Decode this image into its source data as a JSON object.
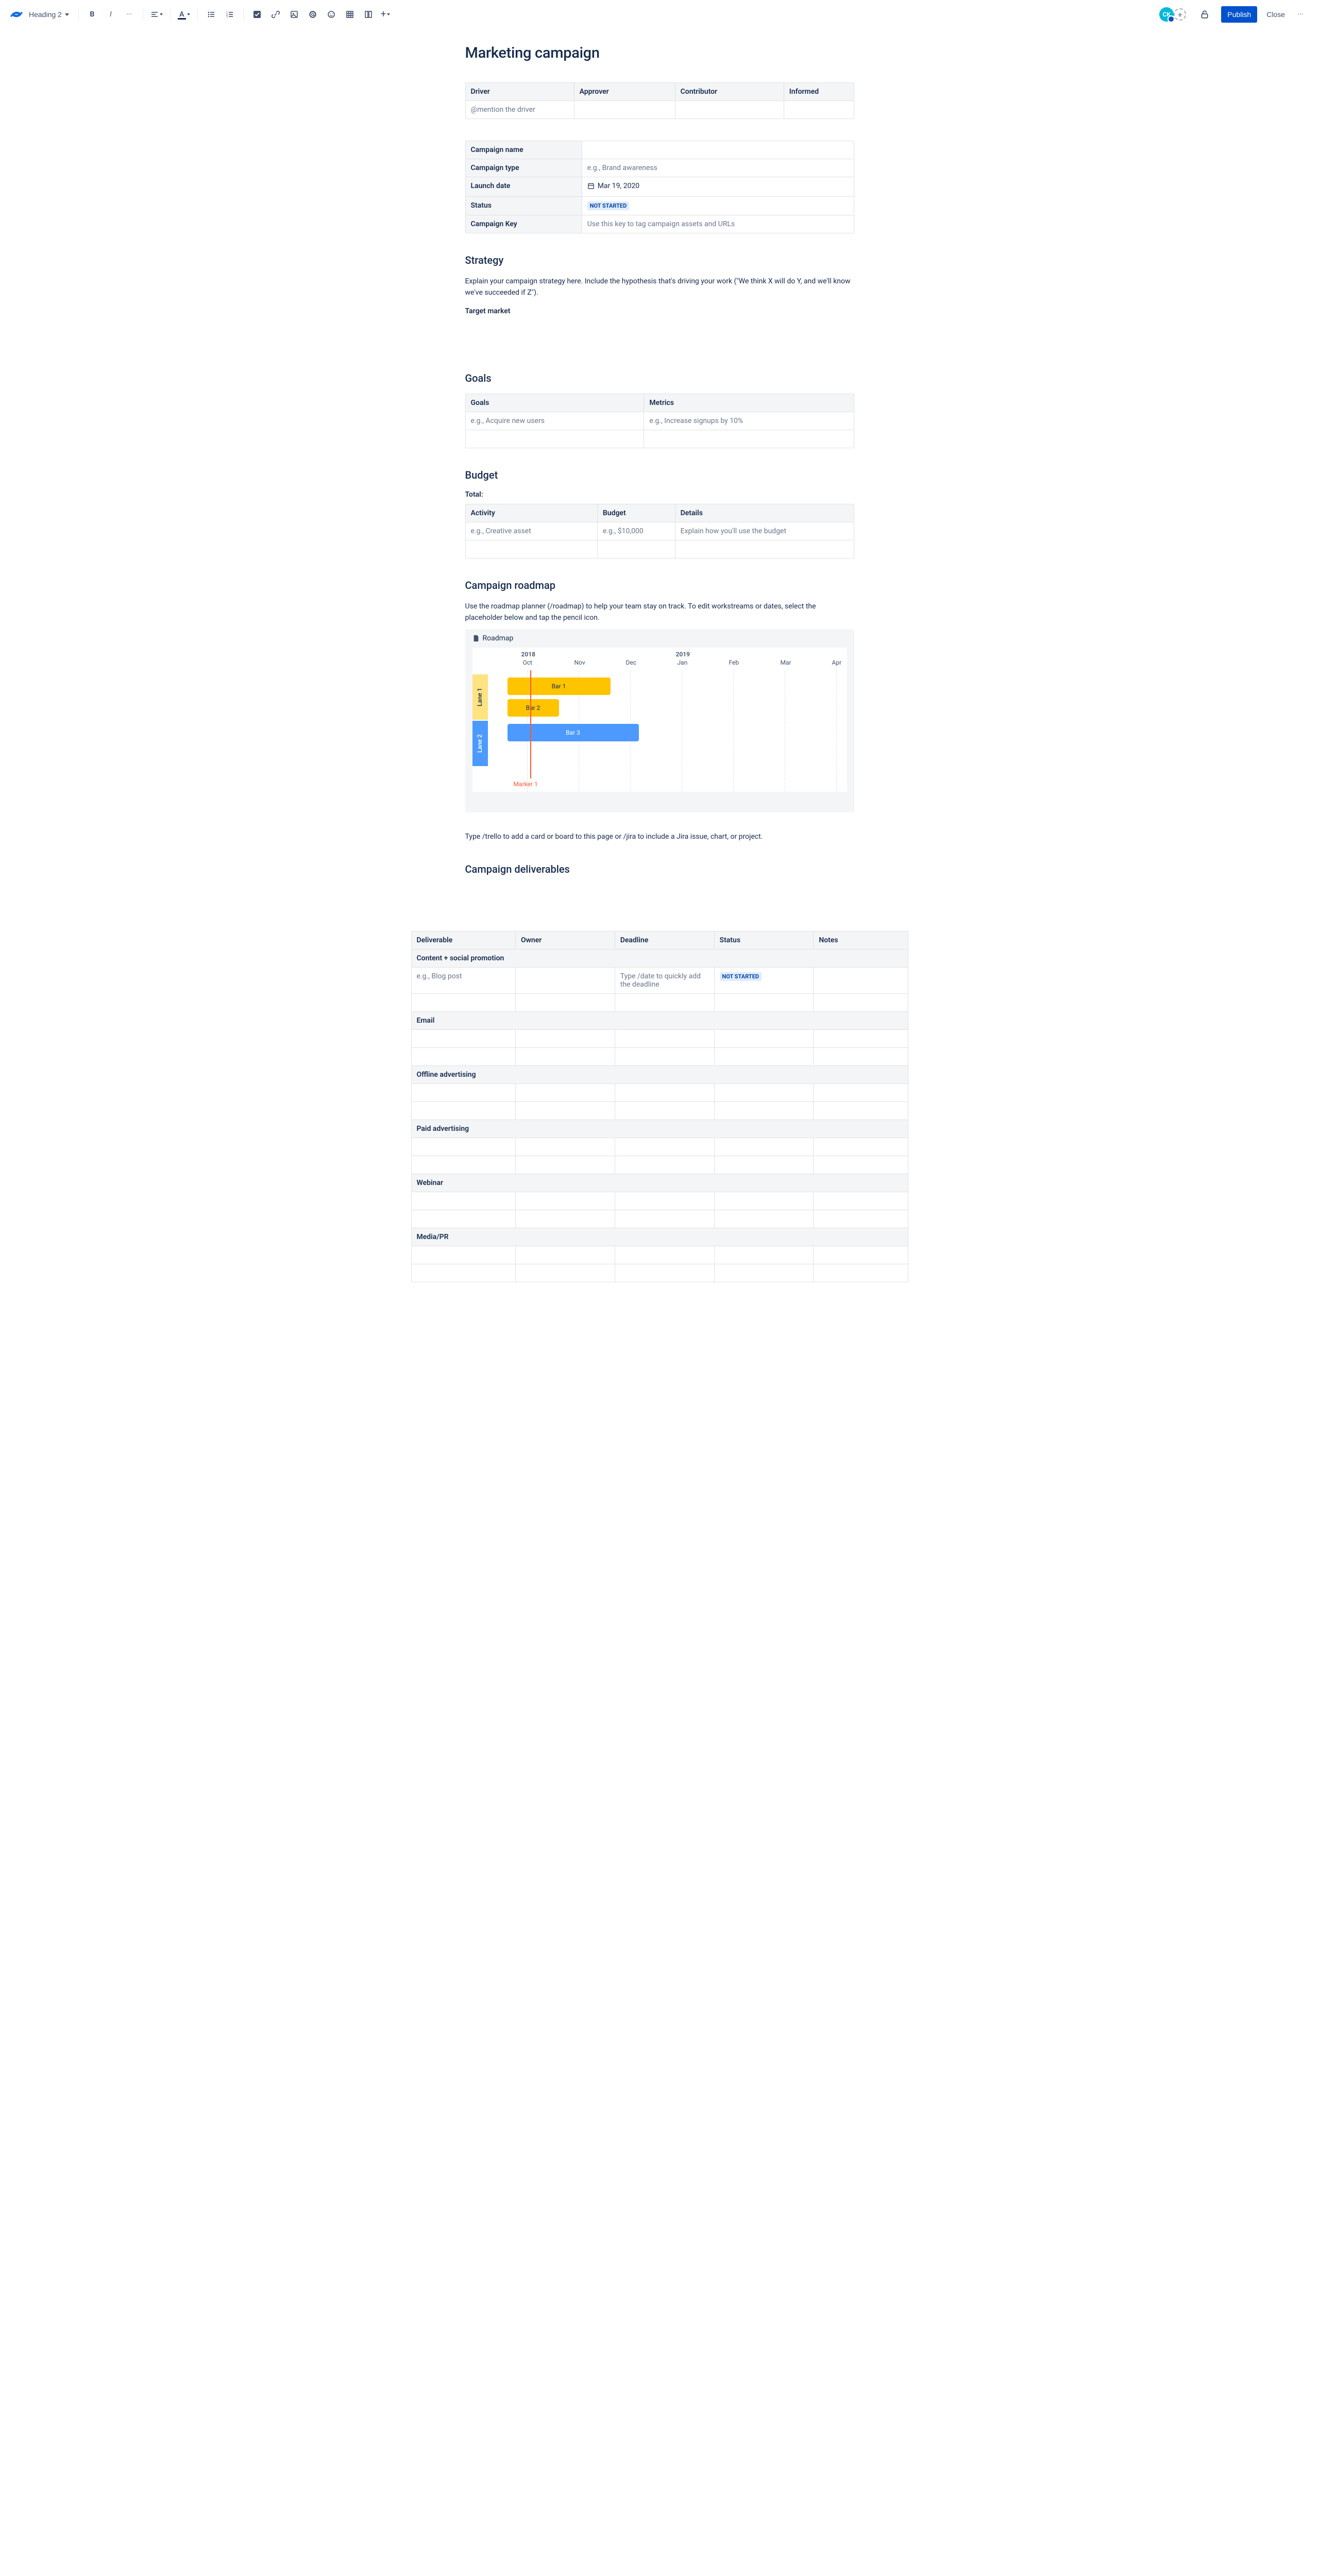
{
  "toolbar": {
    "heading_selector": "Heading 2",
    "publish": "Publish",
    "close": "Close",
    "avatar_initials": "CK"
  },
  "page": {
    "title": "Marketing campaign"
  },
  "raci": {
    "headers": {
      "driver": "Driver",
      "approver": "Approver",
      "contributor": "Contributor",
      "informed": "Informed"
    },
    "row": {
      "driver": "@mention the driver",
      "approver": "",
      "contributor": "",
      "informed": ""
    }
  },
  "details": {
    "campaign_name": {
      "label": "Campaign name",
      "value": ""
    },
    "campaign_type": {
      "label": "Campaign type",
      "value": "e.g., Brand awareness"
    },
    "launch_date": {
      "label": "Launch date",
      "value": "Mar 19, 2020"
    },
    "status": {
      "label": "Status",
      "value": "NOT STARTED"
    },
    "campaign_key": {
      "label": "Campaign Key",
      "value": "Use this key to tag campaign assets and URLs"
    }
  },
  "strategy": {
    "heading": "Strategy",
    "body": "Explain your campaign strategy here. Include the hypothesis that's driving your work (\"We think X will do Y, and we'll know we've succeeded if Z\").",
    "target_market_label": "Target market"
  },
  "goals": {
    "heading": "Goals",
    "headers": {
      "goals": "Goals",
      "metrics": "Metrics"
    },
    "row": {
      "goals": "e.g., Acquire new users",
      "metrics": "e.g., Increase signups by 10%"
    }
  },
  "budget": {
    "heading": "Budget",
    "total_label": "Total:",
    "headers": {
      "activity": "Activity",
      "budget": "Budget",
      "details": "Details"
    },
    "row": {
      "activity": "e.g., Creative asset",
      "budget": "e.g., $10,000",
      "details": "Explain how you'll use the budget"
    }
  },
  "roadmap": {
    "heading": "Campaign roadmap",
    "body": "Use the roadmap planner (/roadmap) to help your team stay on track. To edit workstreams or dates, select the placeholder below and tap the pencil icon.",
    "macro_title": "Roadmap",
    "years": {
      "2018": "2018",
      "2019": "2019"
    },
    "months": [
      "Oct",
      "Nov",
      "Dec",
      "Jan",
      "Feb",
      "Mar",
      "Apr"
    ],
    "lanes": {
      "lane1": "Lane 1",
      "lane2": "Lane 2"
    },
    "bars": {
      "bar1": "Bar 1",
      "bar2": "Bar 2",
      "bar3": "Bar 3"
    },
    "marker": "Marker 1",
    "footer": "Type /trello to add a card or board to this page or /jira to include a Jira issue, chart, or project."
  },
  "deliverables": {
    "heading": "Campaign deliverables",
    "headers": {
      "deliverable": "Deliverable",
      "owner": "Owner",
      "deadline": "Deadline",
      "status": "Status",
      "notes": "Notes"
    },
    "sections": {
      "content": "Content + social promotion",
      "email": "Email",
      "offline": "Offline advertising",
      "paid": "Paid advertising",
      "webinar": "Webinar",
      "media": "Media/PR"
    },
    "sample": {
      "deliverable": "e.g., Blog post",
      "owner": "",
      "deadline": "Type /date to quickly add the deadline",
      "status": "NOT STARTED",
      "notes": ""
    }
  },
  "chart_data": {
    "type": "gantt",
    "time_axis": {
      "start": "2018-10",
      "end": "2019-04",
      "months": [
        "Oct",
        "Nov",
        "Dec",
        "Jan",
        "Feb",
        "Mar",
        "Apr"
      ]
    },
    "lanes": [
      {
        "name": "Lane 1",
        "color": "#FFE380",
        "bars": [
          {
            "name": "Bar 1",
            "start": "2018-10-05",
            "end": "2018-12-05",
            "color": "#FFC400"
          },
          {
            "name": "Bar 2",
            "start": "2018-10-05",
            "end": "2018-11-05",
            "color": "#FFC400"
          }
        ]
      },
      {
        "name": "Lane 2",
        "color": "#4C9AFF",
        "bars": [
          {
            "name": "Bar 3",
            "start": "2018-10-05",
            "end": "2019-01-01",
            "color": "#4C9AFF"
          }
        ]
      }
    ],
    "markers": [
      {
        "name": "Marker 1",
        "date": "2018-10-15",
        "color": "#FF5630"
      }
    ]
  }
}
